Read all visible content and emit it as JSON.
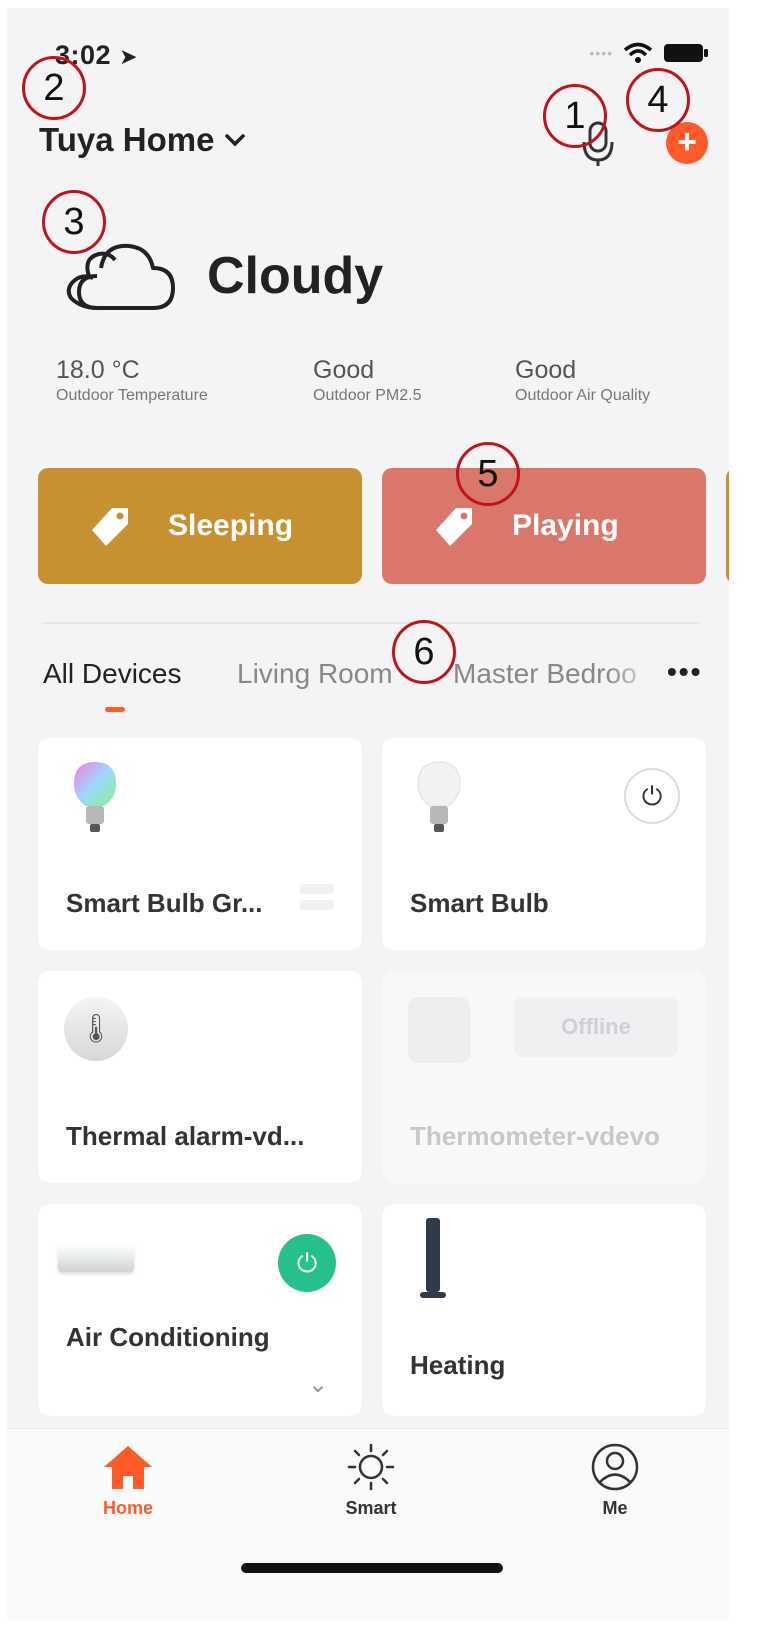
{
  "status_bar": {
    "time": "3:02"
  },
  "header": {
    "home_name": "Tuya Home"
  },
  "weather": {
    "condition": "Cloudy",
    "stats": [
      {
        "value": "18.0 °C",
        "label": "Outdoor Temperature"
      },
      {
        "value": "Good",
        "label": "Outdoor PM2.5"
      },
      {
        "value": "Good",
        "label": "Outdoor Air Quality"
      }
    ]
  },
  "scenes": [
    {
      "label": "Sleeping"
    },
    {
      "label": "Playing"
    }
  ],
  "tabs": [
    {
      "label": "All Devices"
    },
    {
      "label": "Living Room"
    },
    {
      "label": "Master Bedroo"
    }
  ],
  "devices": [
    {
      "name": "Smart Bulb Gr..."
    },
    {
      "name": "Smart Bulb"
    },
    {
      "name": "Thermal alarm-vd..."
    },
    {
      "name": "Thermometer-vdevo",
      "status": "Offline"
    },
    {
      "name": "Air Conditioning"
    },
    {
      "name": "Heating"
    }
  ],
  "bottom_nav": [
    {
      "label": "Home",
      "icon": "home-icon"
    },
    {
      "label": "Smart",
      "icon": "sun-icon"
    },
    {
      "label": "Me",
      "icon": "user-icon"
    }
  ],
  "annotations": [
    "1",
    "2",
    "3",
    "4",
    "5",
    "6"
  ],
  "colors": {
    "accent": "#ff5a28",
    "power_on": "#26c08d",
    "scene_sleeping": "#c79030",
    "scene_playing": "#d9786a"
  }
}
